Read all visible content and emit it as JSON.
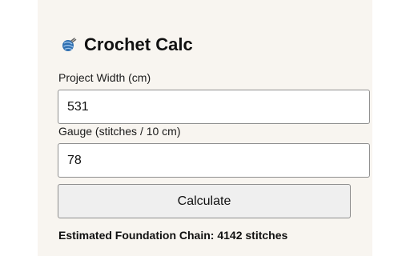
{
  "app": {
    "title": "Crochet Calc",
    "icon": "yarn-ball-icon"
  },
  "form": {
    "width_label": "Project Width (cm)",
    "width_value": "531",
    "gauge_label": "Gauge (stitches / 10 cm)",
    "gauge_value": "78",
    "calculate_label": "Calculate"
  },
  "result": {
    "text": "Estimated Foundation Chain: 4142 stitches"
  },
  "colors": {
    "background": "#f8f5f0",
    "accent": "#2f6fb0"
  }
}
